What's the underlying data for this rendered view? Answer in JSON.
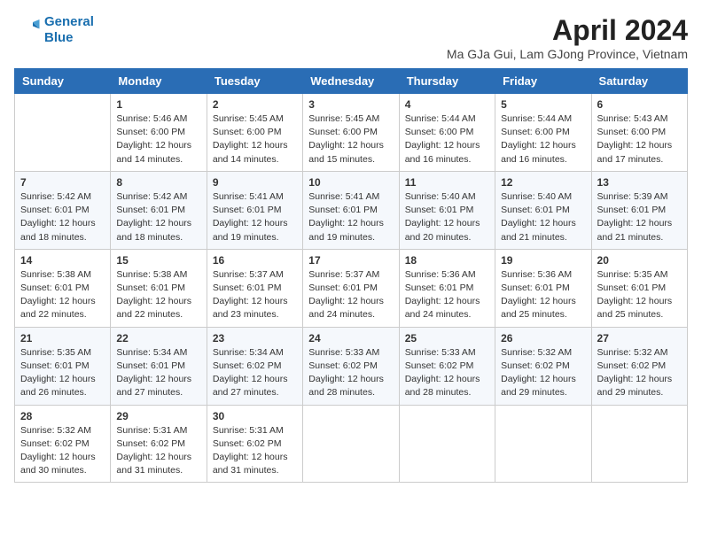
{
  "logo": {
    "line1": "General",
    "line2": "Blue"
  },
  "title": "April 2024",
  "location": "Ma GJa Gui, Lam GJong Province, Vietnam",
  "days_header": [
    "Sunday",
    "Monday",
    "Tuesday",
    "Wednesday",
    "Thursday",
    "Friday",
    "Saturday"
  ],
  "weeks": [
    [
      {
        "day": "",
        "info": ""
      },
      {
        "day": "1",
        "info": "Sunrise: 5:46 AM\nSunset: 6:00 PM\nDaylight: 12 hours\nand 14 minutes."
      },
      {
        "day": "2",
        "info": "Sunrise: 5:45 AM\nSunset: 6:00 PM\nDaylight: 12 hours\nand 14 minutes."
      },
      {
        "day": "3",
        "info": "Sunrise: 5:45 AM\nSunset: 6:00 PM\nDaylight: 12 hours\nand 15 minutes."
      },
      {
        "day": "4",
        "info": "Sunrise: 5:44 AM\nSunset: 6:00 PM\nDaylight: 12 hours\nand 16 minutes."
      },
      {
        "day": "5",
        "info": "Sunrise: 5:44 AM\nSunset: 6:00 PM\nDaylight: 12 hours\nand 16 minutes."
      },
      {
        "day": "6",
        "info": "Sunrise: 5:43 AM\nSunset: 6:00 PM\nDaylight: 12 hours\nand 17 minutes."
      }
    ],
    [
      {
        "day": "7",
        "info": "Sunrise: 5:42 AM\nSunset: 6:01 PM\nDaylight: 12 hours\nand 18 minutes."
      },
      {
        "day": "8",
        "info": "Sunrise: 5:42 AM\nSunset: 6:01 PM\nDaylight: 12 hours\nand 18 minutes."
      },
      {
        "day": "9",
        "info": "Sunrise: 5:41 AM\nSunset: 6:01 PM\nDaylight: 12 hours\nand 19 minutes."
      },
      {
        "day": "10",
        "info": "Sunrise: 5:41 AM\nSunset: 6:01 PM\nDaylight: 12 hours\nand 19 minutes."
      },
      {
        "day": "11",
        "info": "Sunrise: 5:40 AM\nSunset: 6:01 PM\nDaylight: 12 hours\nand 20 minutes."
      },
      {
        "day": "12",
        "info": "Sunrise: 5:40 AM\nSunset: 6:01 PM\nDaylight: 12 hours\nand 21 minutes."
      },
      {
        "day": "13",
        "info": "Sunrise: 5:39 AM\nSunset: 6:01 PM\nDaylight: 12 hours\nand 21 minutes."
      }
    ],
    [
      {
        "day": "14",
        "info": "Sunrise: 5:38 AM\nSunset: 6:01 PM\nDaylight: 12 hours\nand 22 minutes."
      },
      {
        "day": "15",
        "info": "Sunrise: 5:38 AM\nSunset: 6:01 PM\nDaylight: 12 hours\nand 22 minutes."
      },
      {
        "day": "16",
        "info": "Sunrise: 5:37 AM\nSunset: 6:01 PM\nDaylight: 12 hours\nand 23 minutes."
      },
      {
        "day": "17",
        "info": "Sunrise: 5:37 AM\nSunset: 6:01 PM\nDaylight: 12 hours\nand 24 minutes."
      },
      {
        "day": "18",
        "info": "Sunrise: 5:36 AM\nSunset: 6:01 PM\nDaylight: 12 hours\nand 24 minutes."
      },
      {
        "day": "19",
        "info": "Sunrise: 5:36 AM\nSunset: 6:01 PM\nDaylight: 12 hours\nand 25 minutes."
      },
      {
        "day": "20",
        "info": "Sunrise: 5:35 AM\nSunset: 6:01 PM\nDaylight: 12 hours\nand 25 minutes."
      }
    ],
    [
      {
        "day": "21",
        "info": "Sunrise: 5:35 AM\nSunset: 6:01 PM\nDaylight: 12 hours\nand 26 minutes."
      },
      {
        "day": "22",
        "info": "Sunrise: 5:34 AM\nSunset: 6:01 PM\nDaylight: 12 hours\nand 27 minutes."
      },
      {
        "day": "23",
        "info": "Sunrise: 5:34 AM\nSunset: 6:02 PM\nDaylight: 12 hours\nand 27 minutes."
      },
      {
        "day": "24",
        "info": "Sunrise: 5:33 AM\nSunset: 6:02 PM\nDaylight: 12 hours\nand 28 minutes."
      },
      {
        "day": "25",
        "info": "Sunrise: 5:33 AM\nSunset: 6:02 PM\nDaylight: 12 hours\nand 28 minutes."
      },
      {
        "day": "26",
        "info": "Sunrise: 5:32 AM\nSunset: 6:02 PM\nDaylight: 12 hours\nand 29 minutes."
      },
      {
        "day": "27",
        "info": "Sunrise: 5:32 AM\nSunset: 6:02 PM\nDaylight: 12 hours\nand 29 minutes."
      }
    ],
    [
      {
        "day": "28",
        "info": "Sunrise: 5:32 AM\nSunset: 6:02 PM\nDaylight: 12 hours\nand 30 minutes."
      },
      {
        "day": "29",
        "info": "Sunrise: 5:31 AM\nSunset: 6:02 PM\nDaylight: 12 hours\nand 31 minutes."
      },
      {
        "day": "30",
        "info": "Sunrise: 5:31 AM\nSunset: 6:02 PM\nDaylight: 12 hours\nand 31 minutes."
      },
      {
        "day": "",
        "info": ""
      },
      {
        "day": "",
        "info": ""
      },
      {
        "day": "",
        "info": ""
      },
      {
        "day": "",
        "info": ""
      }
    ]
  ]
}
